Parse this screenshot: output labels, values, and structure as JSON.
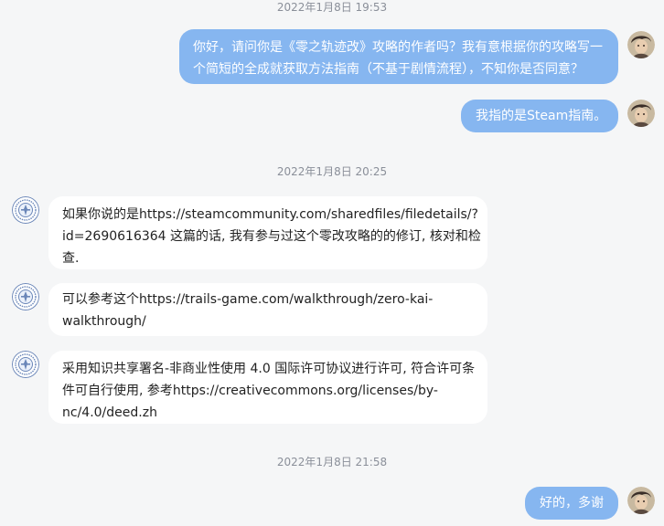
{
  "messages": {
    "ts1": "2022年1月8日 19:53",
    "m1_line1": "你好，请问你是《零之轨迹改》攻略的作者吗？我有意根据你的攻略写一",
    "m1_line2": "个简短的全成就获取方法指南（不基于剧情流程），不知你是否同意？",
    "m2": "我指的是Steam指南。",
    "ts2": "2022年1月8日 20:25",
    "r1_line1": "如果你说的是https://steamcommunity.com/sharedfiles/filedetails/?",
    "r1_line2": "id=2690616364 这篇的话, 我有参与过这个零改攻略的的修订, 核对和检",
    "r1_line3": "查.",
    "r2_line1": "可以参考这个https://trails-game.com/walkthrough/zero-kai-",
    "r2_line2": "walkthrough/",
    "r3_line1": "采用知识共享署名-非商业性使用 4.0 国际许可协议进行许可, 符合许可条",
    "r3_line2": "件可自行使用, 参考https://creativecommons.org/licenses/by-",
    "r3_line3": "nc/4.0/deed.zh",
    "ts3": "2022年1月8日 21:58",
    "m3": "好的，多谢"
  },
  "avatars": {
    "me": "user-avatar",
    "other": "seal-avatar"
  },
  "colors": {
    "background": "#f5f6f7",
    "my_bubble": "#86b6f0",
    "other_bubble": "#ffffff",
    "timestamp": "#8a8f99"
  }
}
